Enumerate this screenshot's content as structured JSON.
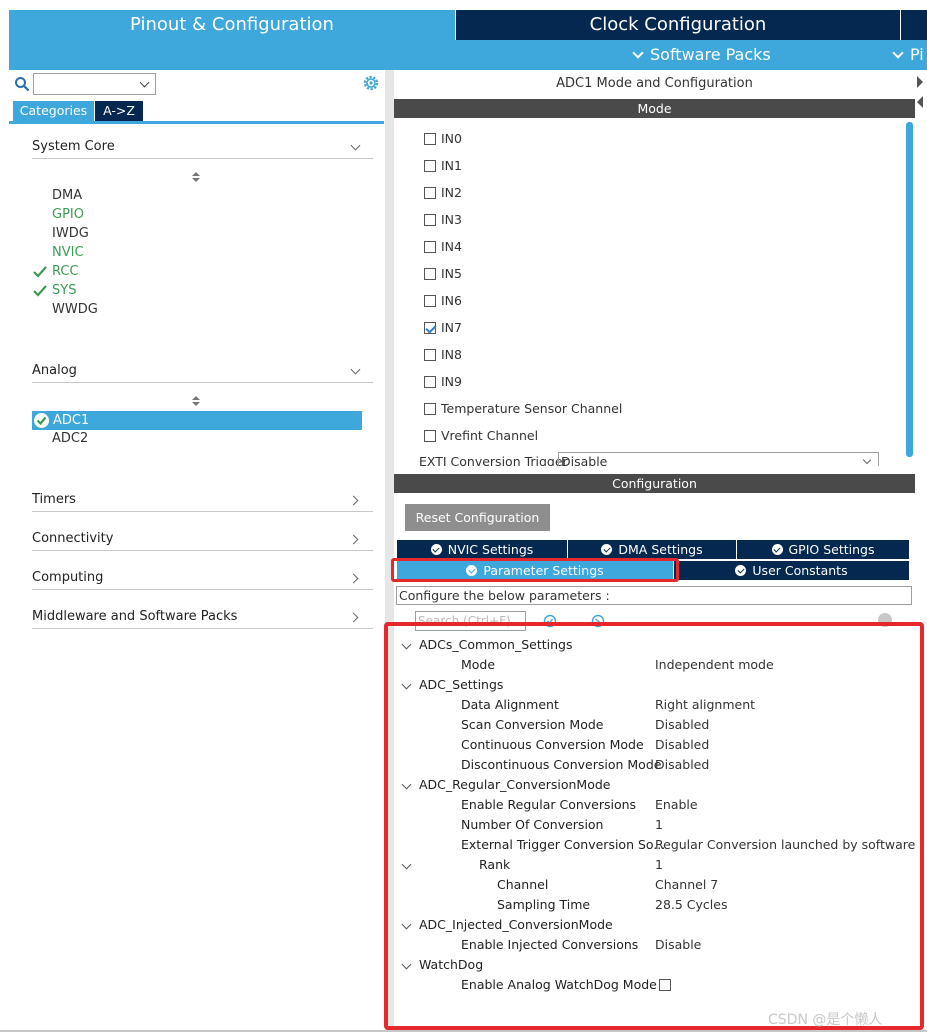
{
  "top_tabs": {
    "pinout": "Pinout & Configuration",
    "clock": "Clock Configuration"
  },
  "sub_menu": {
    "software_packs": "Software Packs",
    "pinout_short": "Pi"
  },
  "left_panel": {
    "tabs": {
      "categories": "Categories",
      "az": "A->Z"
    },
    "sections": {
      "system_core": {
        "label": "System Core",
        "items": [
          "DMA",
          "GPIO",
          "IWDG",
          "NVIC",
          "RCC",
          "SYS",
          "WWDG"
        ]
      },
      "analog": {
        "label": "Analog",
        "items": [
          "ADC1",
          "ADC2"
        ]
      },
      "timers": "Timers",
      "connectivity": "Connectivity",
      "computing": "Computing",
      "middleware": "Middleware and Software Packs"
    }
  },
  "mode_panel": {
    "title": "ADC1 Mode and Configuration",
    "header": "Mode",
    "channels": [
      {
        "label": "IN0",
        "checked": false
      },
      {
        "label": "IN1",
        "checked": false
      },
      {
        "label": "IN2",
        "checked": false
      },
      {
        "label": "IN3",
        "checked": false
      },
      {
        "label": "IN4",
        "checked": false
      },
      {
        "label": "IN5",
        "checked": false
      },
      {
        "label": "IN6",
        "checked": false
      },
      {
        "label": "IN7",
        "checked": true
      },
      {
        "label": "IN8",
        "checked": false
      },
      {
        "label": "IN9",
        "checked": false
      },
      {
        "label": "Temperature Sensor Channel",
        "checked": false
      },
      {
        "label": "Vrefint Channel",
        "checked": false
      }
    ],
    "exti_label": "EXTI Conversion Trigger",
    "exti_value": "Disable"
  },
  "config_panel": {
    "header": "Configuration",
    "reset_button": "Reset Configuration",
    "tabs": {
      "nvic": "NVIC Settings",
      "dma": "DMA Settings",
      "gpio": "GPIO Settings",
      "parameter": "Parameter Settings",
      "user_constants": "User Constants"
    },
    "configure_text": "Configure the below parameters :",
    "search_placeholder": "Search (Ctrl+F)"
  },
  "params": {
    "common": {
      "label": "ADCs_Common_Settings",
      "mode_label": "Mode",
      "mode_value": "Independent mode"
    },
    "adc_settings": {
      "label": "ADC_Settings",
      "rows": [
        {
          "label": "Data Alignment",
          "value": "Right alignment"
        },
        {
          "label": "Scan Conversion Mode",
          "value": "Disabled"
        },
        {
          "label": "Continuous Conversion Mode",
          "value": "Disabled"
        },
        {
          "label": "Discontinuous Conversion Mode",
          "value": "Disabled"
        }
      ]
    },
    "regular": {
      "label": "ADC_Regular_ConversionMode",
      "rows": [
        {
          "label": "Enable Regular Conversions",
          "value": "Enable"
        },
        {
          "label": "Number Of Conversion",
          "value": "1"
        },
        {
          "label": "External Trigger Conversion So...",
          "value": "Regular Conversion launched by software"
        }
      ],
      "rank_label": "Rank",
      "rank_value": "1",
      "rank_rows": [
        {
          "label": "Channel",
          "value": "Channel 7"
        },
        {
          "label": "Sampling Time",
          "value": "28.5 Cycles"
        }
      ]
    },
    "injected": {
      "label": "ADC_Injected_ConversionMode",
      "row_label": "Enable Injected Conversions",
      "row_value": "Disable"
    },
    "watchdog": {
      "label": "WatchDog",
      "row_label": "Enable Analog WatchDog Mode"
    }
  },
  "watermark": "CSDN @是个懒人",
  "colors": {
    "accent_blue": "#3ea7db",
    "navy": "#04284f",
    "header_gray": "#4a4a4a",
    "ok_green": "#3c9a54",
    "highlight_red": "#e4282b"
  }
}
